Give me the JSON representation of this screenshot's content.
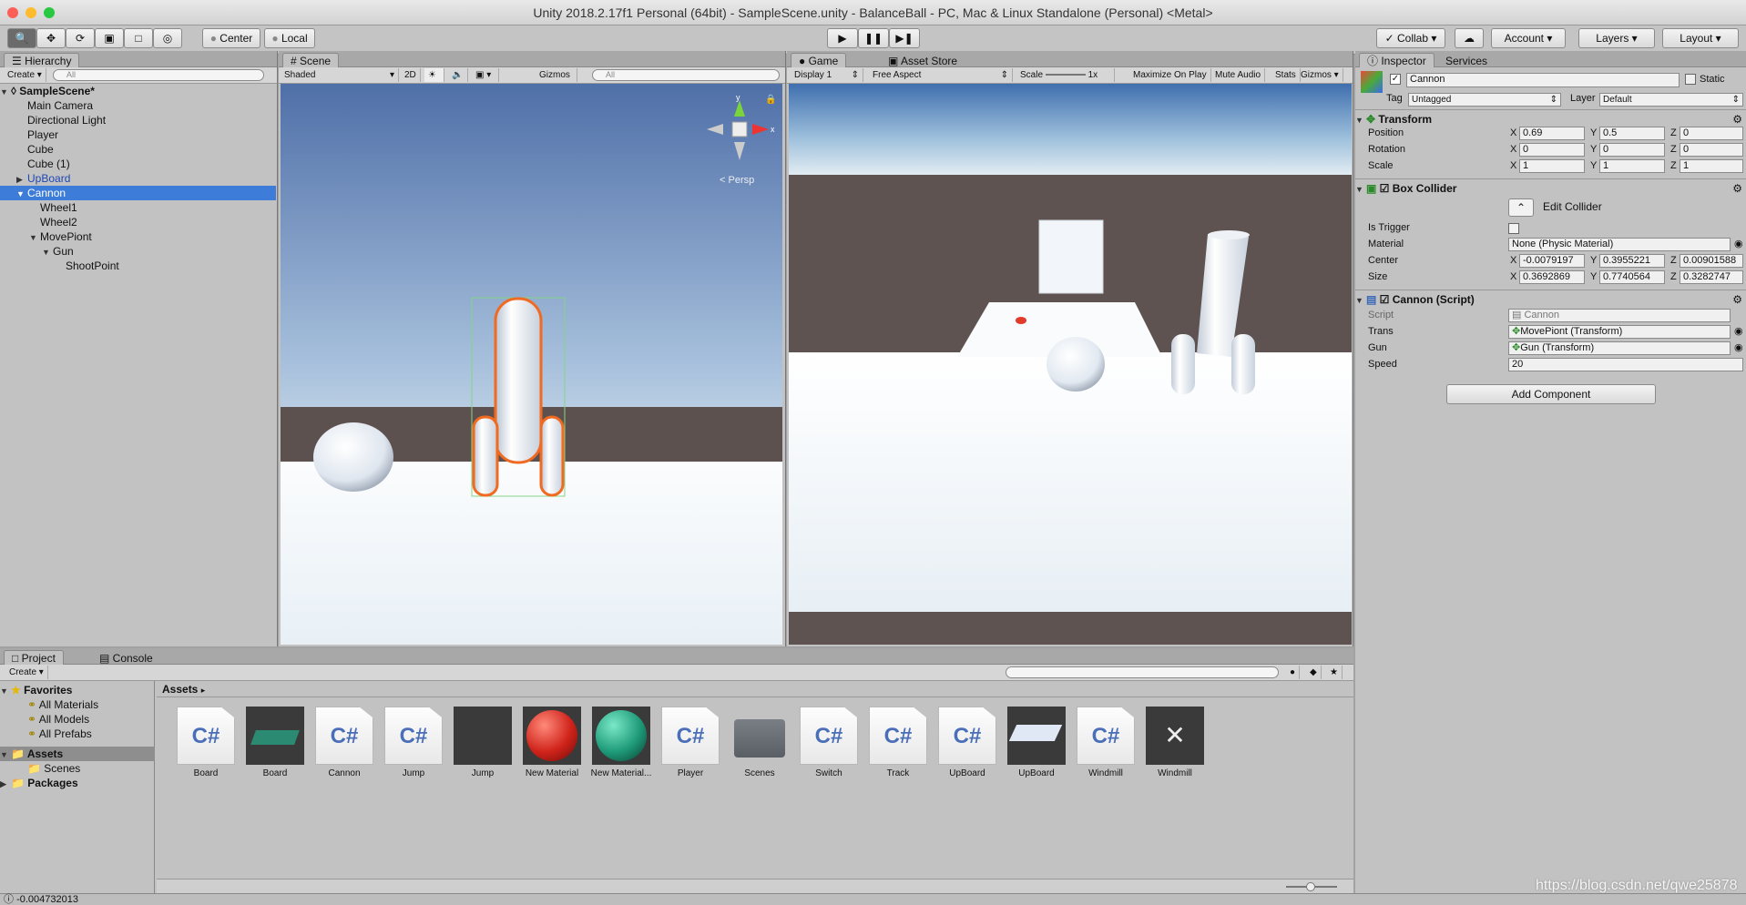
{
  "window": {
    "title": "Unity 2018.2.17f1 Personal (64bit) - SampleScene.unity - BalanceBall - PC, Mac & Linux Standalone (Personal) <Metal>"
  },
  "colors": {
    "selection": "#3d7cd8",
    "outline": "#f06a22",
    "prefab_text": "#1d48b5"
  },
  "toolbar": {
    "tools": [
      "hand-tool",
      "move-tool",
      "rotate-tool",
      "scale-tool",
      "rect-tool",
      "transform-tool"
    ],
    "pivot": "Center",
    "space": "Local",
    "collab": "Collab",
    "account": "Account",
    "layers": "Layers",
    "layout": "Layout"
  },
  "hierarchy": {
    "tab": "Hierarchy",
    "create": "Create",
    "search_placeholder": "All",
    "scene": "SampleScene*",
    "items": [
      {
        "label": "Main Camera"
      },
      {
        "label": "Directional Light"
      },
      {
        "label": "Player"
      },
      {
        "label": "Cube"
      },
      {
        "label": "Cube (1)"
      },
      {
        "label": "UpBoard"
      },
      {
        "label": "Cannon"
      },
      {
        "label": "Wheel1"
      },
      {
        "label": "Wheel2"
      },
      {
        "label": "MovePiont"
      },
      {
        "label": "Gun"
      },
      {
        "label": "ShootPoint"
      }
    ]
  },
  "scene": {
    "tab": "Scene",
    "shading": "Shaded",
    "mode2d": "2D",
    "gizmos": "Gizmos",
    "search_placeholder": "All",
    "persp": "Persp",
    "gizmo_axes": {
      "x": "x",
      "y": "y"
    }
  },
  "game": {
    "tab": "Game",
    "asset_store": "Asset Store",
    "display": "Display 1",
    "aspect": "Free Aspect",
    "scale_label": "Scale",
    "scale_value": "1x",
    "maximize": "Maximize On Play",
    "mute": "Mute Audio",
    "stats": "Stats",
    "gizmos": "Gizmos"
  },
  "inspector": {
    "tab": "Inspector",
    "services": "Services",
    "name": "Cannon",
    "static": "Static",
    "tag_label": "Tag",
    "tag": "Untagged",
    "layer_label": "Layer",
    "layer": "Default",
    "transform": {
      "title": "Transform",
      "rows": [
        {
          "label": "Position",
          "x": "0.69",
          "y": "0.5",
          "z": "0"
        },
        {
          "label": "Rotation",
          "x": "0",
          "y": "0",
          "z": "0"
        },
        {
          "label": "Scale",
          "x": "1",
          "y": "1",
          "z": "1"
        }
      ]
    },
    "box_collider": {
      "title": "Box Collider",
      "edit": "Edit Collider",
      "trigger_label": "Is Trigger",
      "material_label": "Material",
      "material": "None (Physic Material)",
      "center": {
        "label": "Center",
        "x": "-0.0079197",
        "y": "0.3955221",
        "z": "0.00901588"
      },
      "size": {
        "label": "Size",
        "x": "0.3692869",
        "y": "0.7740564",
        "z": "0.3282747"
      }
    },
    "script": {
      "title": "Cannon (Script)",
      "script_label": "Script",
      "script": "Cannon",
      "trans_label": "Trans",
      "trans": "MovePiont (Transform)",
      "gun_label": "Gun",
      "gun": "Gun (Transform)",
      "speed_label": "Speed",
      "speed": "20"
    },
    "add_component": "Add Component",
    "axis": {
      "x": "X",
      "y": "Y",
      "z": "Z"
    }
  },
  "project": {
    "tab": "Project",
    "console": "Console",
    "create": "Create",
    "breadcrumb": "Assets",
    "tree": [
      {
        "label": "Favorites"
      },
      {
        "label": "All Materials"
      },
      {
        "label": "All Models"
      },
      {
        "label": "All Prefabs"
      },
      {
        "label": "Assets"
      },
      {
        "label": "Scenes"
      },
      {
        "label": "Packages"
      }
    ],
    "assets": [
      {
        "name": "Board",
        "kind": "cs"
      },
      {
        "name": "Board",
        "kind": "prefab-green"
      },
      {
        "name": "Cannon",
        "kind": "cs"
      },
      {
        "name": "Jump",
        "kind": "cs"
      },
      {
        "name": "Jump",
        "kind": "dark"
      },
      {
        "name": "New Material",
        "kind": "red-sphere"
      },
      {
        "name": "New Material...",
        "kind": "teal-sphere"
      },
      {
        "name": "Player",
        "kind": "cs"
      },
      {
        "name": "Scenes",
        "kind": "folder"
      },
      {
        "name": "Switch",
        "kind": "cs"
      },
      {
        "name": "Track",
        "kind": "cs"
      },
      {
        "name": "UpBoard",
        "kind": "cs"
      },
      {
        "name": "UpBoard",
        "kind": "prefab-board"
      },
      {
        "name": "Windmill",
        "kind": "cs"
      },
      {
        "name": "Windmill",
        "kind": "prefab-windmill"
      }
    ],
    "cs_label": "C#"
  },
  "status": {
    "text": "-0.004732013"
  },
  "watermark": "https://blog.csdn.net/qwe25878"
}
